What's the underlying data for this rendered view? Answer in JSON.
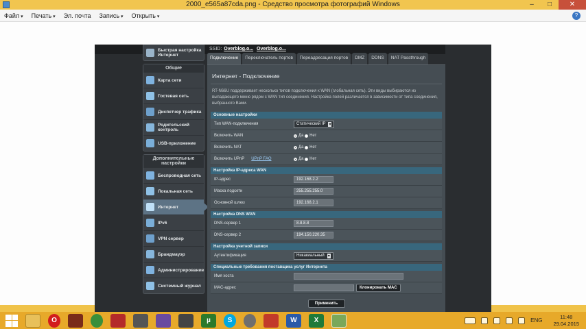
{
  "window": {
    "title": "2000_e565a87cda.png - Средство просмотра фотографий Windows"
  },
  "menubar": {
    "items": [
      {
        "label": "Файл",
        "caret": true
      },
      {
        "label": "Печать",
        "caret": true
      },
      {
        "label": "Эл. почта",
        "caret": false
      },
      {
        "label": "Запись",
        "caret": true
      },
      {
        "label": "Открыть",
        "caret": true
      }
    ],
    "caret": "▾",
    "help": "?"
  },
  "router": {
    "ssid_label": "SSID:",
    "ssid1": "Overblog.o...",
    "ssid2": "Overblog.o...",
    "sidebar": {
      "quick_setup": "Быстрая настройка Интернет",
      "general_head": "Общие",
      "general_items": [
        "Карта сети",
        "Гостевая сеть",
        "Диспетчер трафика",
        "Родительский контроль",
        "USB-приложение"
      ],
      "advanced_head": "Дополнительные настройки",
      "advanced_items": [
        "Беспроводная сеть",
        "Локальная сеть",
        "Интернет",
        "IPv6",
        "VPN сервер",
        "Брандмауэр",
        "Администрирование",
        "Системный журнал"
      ],
      "active": "Интернет"
    },
    "tabs": [
      "Подключение",
      "Переключатель портов",
      "Переадресация портов",
      "DMZ",
      "DDNS",
      "NAT Passthrough"
    ],
    "page_title": "Интернет - Подключение",
    "description": "RT-N66U поддерживает несколько типов подключения к WAN (глобальная сеть). Эти виды выбираются из выпадающего меню рядом с WAN тип соединения. Настройка полей различается в зависимости от типа соединения, выбранного Вами.",
    "basic": {
      "head": "Основные настройки",
      "wan_type_label": "Тип WAN-подключения",
      "wan_type_value": "Статический IP",
      "enable_wan_label": "Включить WAN",
      "enable_nat_label": "Включить NAT",
      "enable_upnp_label": "Включить UPnP",
      "upnp_faq": "UPnP FAQ",
      "yes": "Да",
      "no": "Нет"
    },
    "wan_ip": {
      "head": "Настройка IP-адреса WAN",
      "ip_label": "IP-адрес",
      "ip_value": "192.168.2.2",
      "mask_label": "Маска подсети",
      "mask_value": "255.255.255.0",
      "gw_label": "Основной шлюз",
      "gw_value": "192.168.2.1"
    },
    "dns": {
      "head": "Настройка DNS WAN",
      "dns1_label": "DNS-сервер 1",
      "dns1_value": "8.8.8.8",
      "dns2_label": "DNS-сервер 2",
      "dns2_value": "194.150.220.35"
    },
    "account": {
      "head": "Настройка учетной записи",
      "auth_label": "Аутентификация",
      "auth_value": "Никакиальный"
    },
    "isp": {
      "head": "Специальные требования поставщика услуг Интернета",
      "host_label": "Имя хоста",
      "mac_label": "MAC-адрес",
      "clone_btn": "Клонировать MAC"
    },
    "apply_btn": "Применить"
  },
  "taskbar": {
    "lang": "ENG",
    "time": "11:48",
    "date": "29.04.2015"
  }
}
